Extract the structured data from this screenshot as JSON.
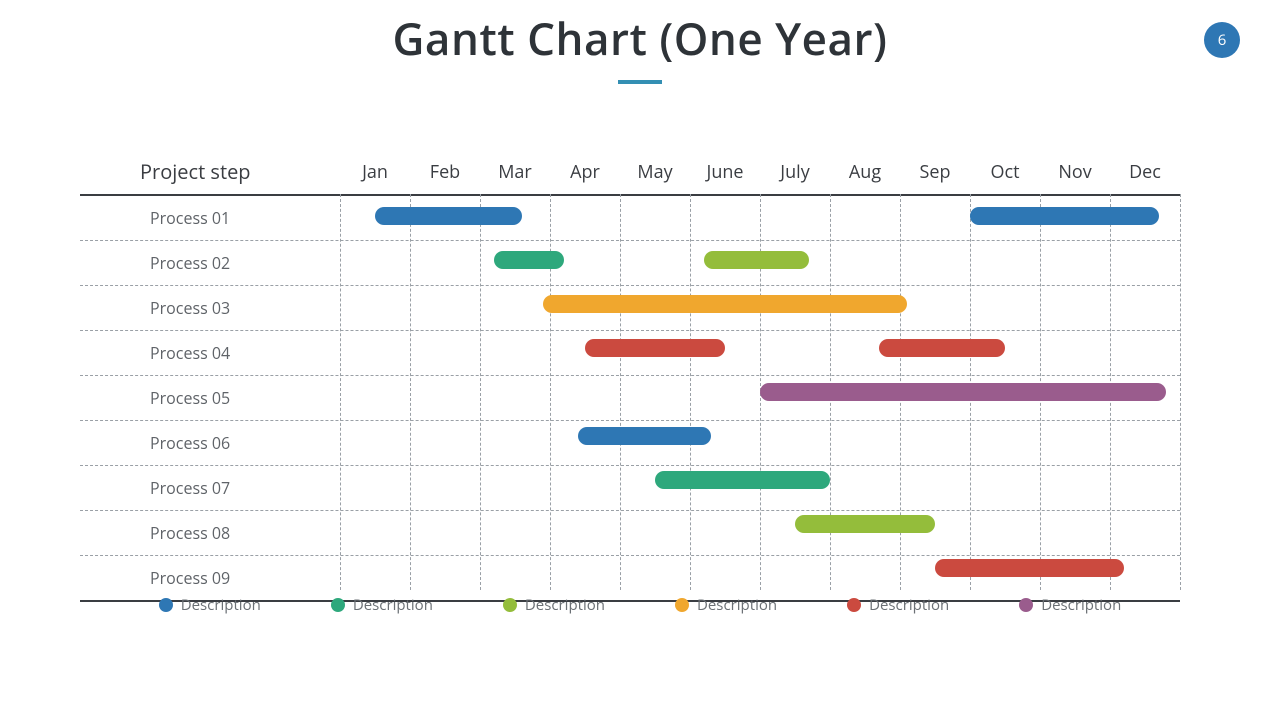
{
  "title": "Gantt Chart (One Year)",
  "page_number": "6",
  "project_step_header": "Project step",
  "months": [
    "Jan",
    "Feb",
    "Mar",
    "Apr",
    "May",
    "June",
    "July",
    "Aug",
    "Sep",
    "Oct",
    "Nov",
    "Dec"
  ],
  "rows": [
    "Process 01",
    "Process 02",
    "Process 03",
    "Process 04",
    "Process 05",
    "Process 06",
    "Process 07",
    "Process 08",
    "Process 09"
  ],
  "colors": {
    "blue": "#2e77b4",
    "green": "#2ea87c",
    "olive": "#94bd3b",
    "orange": "#f0a72e",
    "red": "#cb4a3f",
    "purple": "#9a5c8d"
  },
  "legend": [
    {
      "label": "Description",
      "color": "blue"
    },
    {
      "label": "Description",
      "color": "green"
    },
    {
      "label": "Description",
      "color": "olive"
    },
    {
      "label": "Description",
      "color": "orange"
    },
    {
      "label": "Description",
      "color": "red"
    },
    {
      "label": "Description",
      "color": "purple"
    }
  ],
  "chart_data": {
    "type": "gantt",
    "title": "Gantt Chart (One Year)",
    "x_categories": [
      "Jan",
      "Feb",
      "Mar",
      "Apr",
      "May",
      "June",
      "July",
      "Aug",
      "Sep",
      "Oct",
      "Nov",
      "Dec"
    ],
    "y_categories": [
      "Process 01",
      "Process 02",
      "Process 03",
      "Process 04",
      "Process 05",
      "Process 06",
      "Process 07",
      "Process 08",
      "Process 09"
    ],
    "xlim": [
      0.5,
      12.5
    ],
    "bars": [
      {
        "row": "Process 01",
        "start": 1.0,
        "end": 3.1,
        "color": "blue"
      },
      {
        "row": "Process 01",
        "start": 9.5,
        "end": 12.2,
        "color": "blue"
      },
      {
        "row": "Process 02",
        "start": 2.7,
        "end": 3.7,
        "color": "green"
      },
      {
        "row": "Process 02",
        "start": 5.7,
        "end": 7.2,
        "color": "olive"
      },
      {
        "row": "Process 03",
        "start": 3.4,
        "end": 8.6,
        "color": "orange"
      },
      {
        "row": "Process 04",
        "start": 4.0,
        "end": 6.0,
        "color": "red"
      },
      {
        "row": "Process 04",
        "start": 8.2,
        "end": 10.0,
        "color": "red"
      },
      {
        "row": "Process 05",
        "start": 6.5,
        "end": 12.3,
        "color": "purple"
      },
      {
        "row": "Process 06",
        "start": 3.9,
        "end": 5.8,
        "color": "blue"
      },
      {
        "row": "Process 07",
        "start": 5.0,
        "end": 7.5,
        "color": "green"
      },
      {
        "row": "Process 08",
        "start": 7.0,
        "end": 9.0,
        "color": "olive"
      },
      {
        "row": "Process 09",
        "start": 9.0,
        "end": 11.7,
        "color": "red"
      }
    ]
  }
}
